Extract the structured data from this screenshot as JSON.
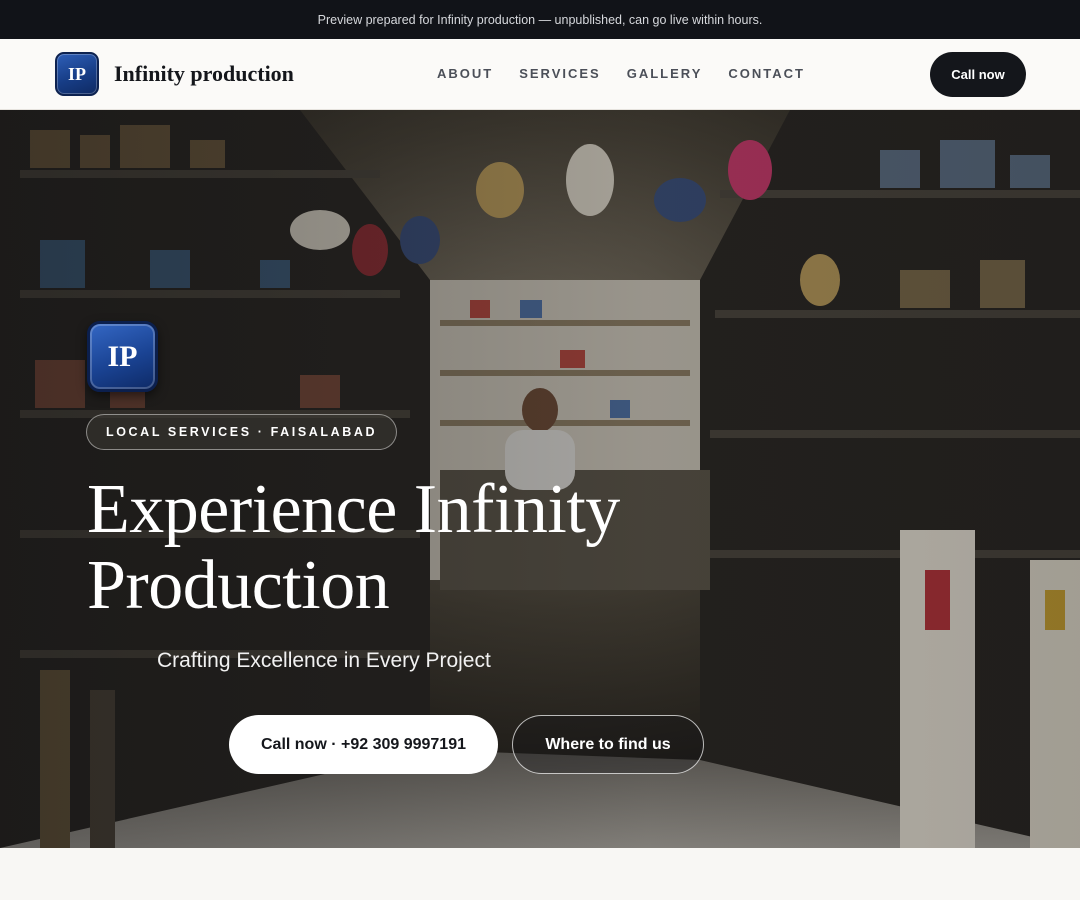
{
  "preview_bar": {
    "text": "Preview prepared for Infinity production — unpublished, can go live within hours."
  },
  "header": {
    "logo_initials": "IP",
    "brand_name": "Infinity production",
    "nav": [
      {
        "label": "ABOUT"
      },
      {
        "label": "SERVICES"
      },
      {
        "label": "GALLERY"
      },
      {
        "label": "CONTACT"
      }
    ],
    "cta_label": "Call now"
  },
  "hero": {
    "logo_initials": "IP",
    "tag": "LOCAL SERVICES · FAISALABAD",
    "title_line1": "Experience Infinity",
    "title_line2": "Production",
    "subtitle": "Crafting Excellence in Every Project",
    "primary_button": "Call now · +92 309 9997191",
    "secondary_button": "Where to find us",
    "background_image": "shop-interior-photo"
  },
  "colors": {
    "dark": "#14161b",
    "logo_blue": "#1a4393",
    "page_bg": "#f8f7f4"
  }
}
